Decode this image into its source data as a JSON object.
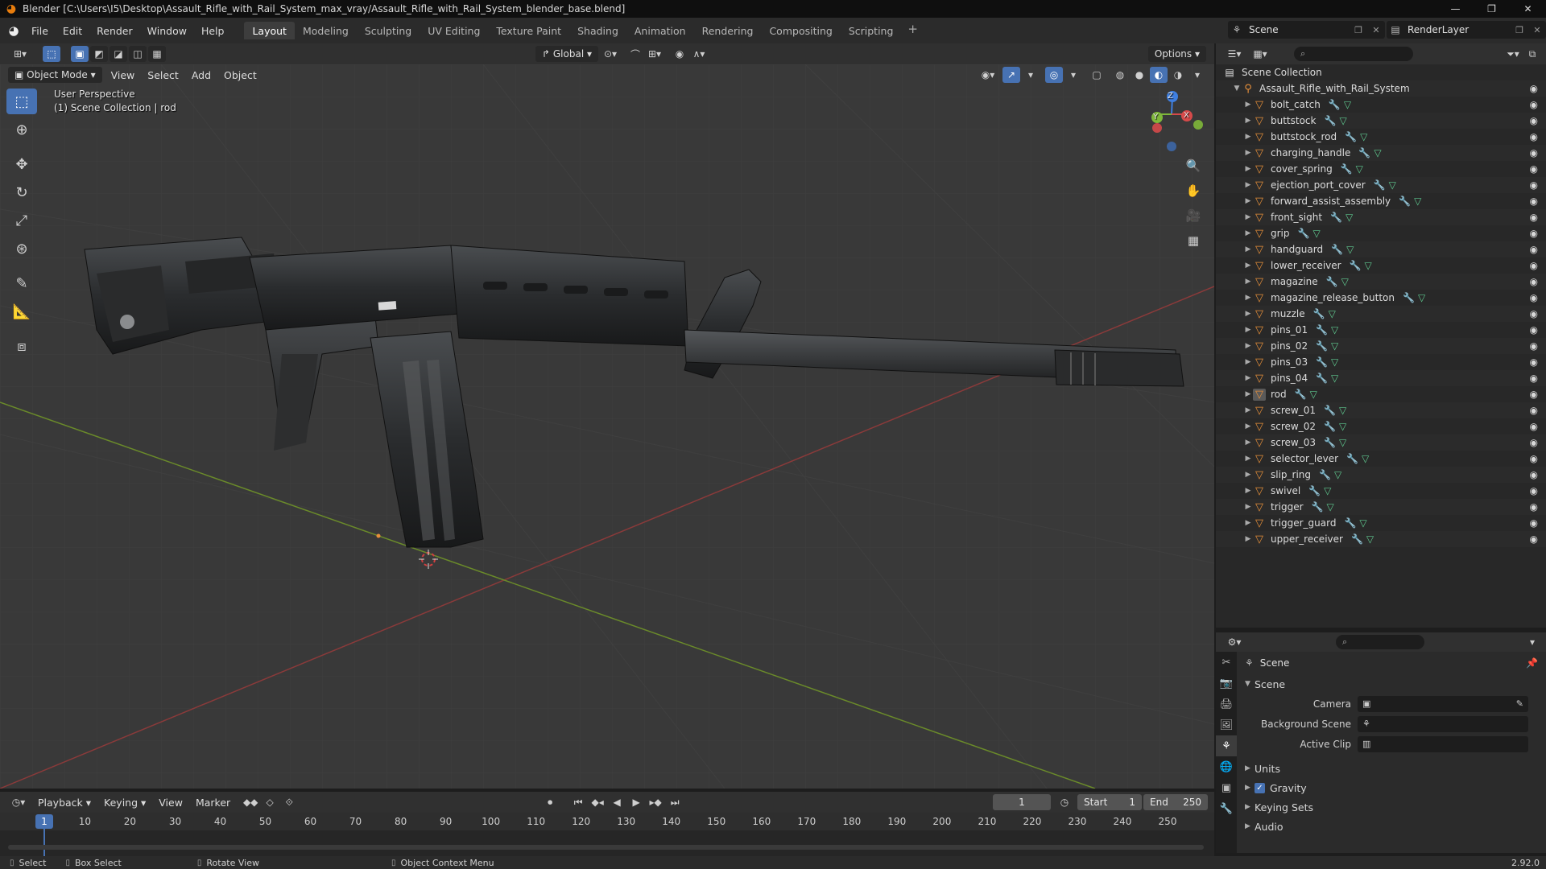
{
  "window": {
    "title": "Blender [C:\\Users\\I5\\Desktop\\Assault_Rifle_with_Rail_System_max_vray/Assault_Rifle_with_Rail_System_blender_base.blend]",
    "minimize": "—",
    "maximize": "❐",
    "close": "✕"
  },
  "menubar": {
    "items": [
      "File",
      "Edit",
      "Render",
      "Window",
      "Help"
    ],
    "workspaces": [
      "Layout",
      "Modeling",
      "Sculpting",
      "UV Editing",
      "Texture Paint",
      "Shading",
      "Animation",
      "Rendering",
      "Compositing",
      "Scripting"
    ],
    "active_workspace": "Layout",
    "scene": "Scene",
    "render_layer": "RenderLayer"
  },
  "viewport_header": {
    "transform_orientation": "Global",
    "options": "Options",
    "mode": "Object Mode",
    "menus": [
      "View",
      "Select",
      "Add",
      "Object"
    ]
  },
  "viewport": {
    "perspective": "User Perspective",
    "collection_info": "(1) Scene Collection | rod",
    "gizmo": {
      "x": "X",
      "y": "Y",
      "z": "Z"
    }
  },
  "outliner": {
    "root": "Scene Collection",
    "collection": "Assault_Rifle_with_Rail_System",
    "objects": [
      "bolt_catch",
      "buttstock",
      "buttstock_rod",
      "charging_handle",
      "cover_spring",
      "ejection_port_cover",
      "forward_assist_assembly",
      "front_sight",
      "grip",
      "handguard",
      "lower_receiver",
      "magazine",
      "magazine_release_button",
      "muzzle",
      "pins_01",
      "pins_02",
      "pins_03",
      "pins_04",
      "rod",
      "screw_01",
      "screw_02",
      "screw_03",
      "selector_lever",
      "slip_ring",
      "swivel",
      "trigger",
      "trigger_guard",
      "upper_receiver"
    ],
    "active_object": "rod"
  },
  "properties": {
    "context": "Scene",
    "panel": "Scene",
    "fields": [
      {
        "label": "Camera",
        "value": ""
      },
      {
        "label": "Background Scene",
        "value": ""
      },
      {
        "label": "Active Clip",
        "value": ""
      }
    ],
    "subpanels": [
      "Units",
      "Gravity",
      "Keying Sets",
      "Audio"
    ]
  },
  "timeline": {
    "menus": [
      "Playback",
      "Keying",
      "View",
      "Marker"
    ],
    "current_frame": "1",
    "start_label": "Start",
    "start": "1",
    "end_label": "End",
    "end": "250",
    "ticks": [
      "1",
      "10",
      "20",
      "30",
      "40",
      "50",
      "60",
      "70",
      "80",
      "90",
      "100",
      "110",
      "120",
      "130",
      "140",
      "150",
      "160",
      "170",
      "180",
      "190",
      "200",
      "210",
      "220",
      "230",
      "240",
      "250"
    ]
  },
  "statusbar": {
    "select": "Select",
    "box_select": "Box Select",
    "rotate": "Rotate View",
    "context_menu": "Object Context Menu",
    "version": "2.92.0"
  },
  "colors": {
    "accent": "#4772b3",
    "object_icon": "#e8903a",
    "modifier_icon": "#6d8ee0",
    "mesh_icon": "#5fc98f",
    "x_axis": "#d64a4a",
    "y_axis": "#7fb83a",
    "z_axis": "#3f7fe0"
  }
}
